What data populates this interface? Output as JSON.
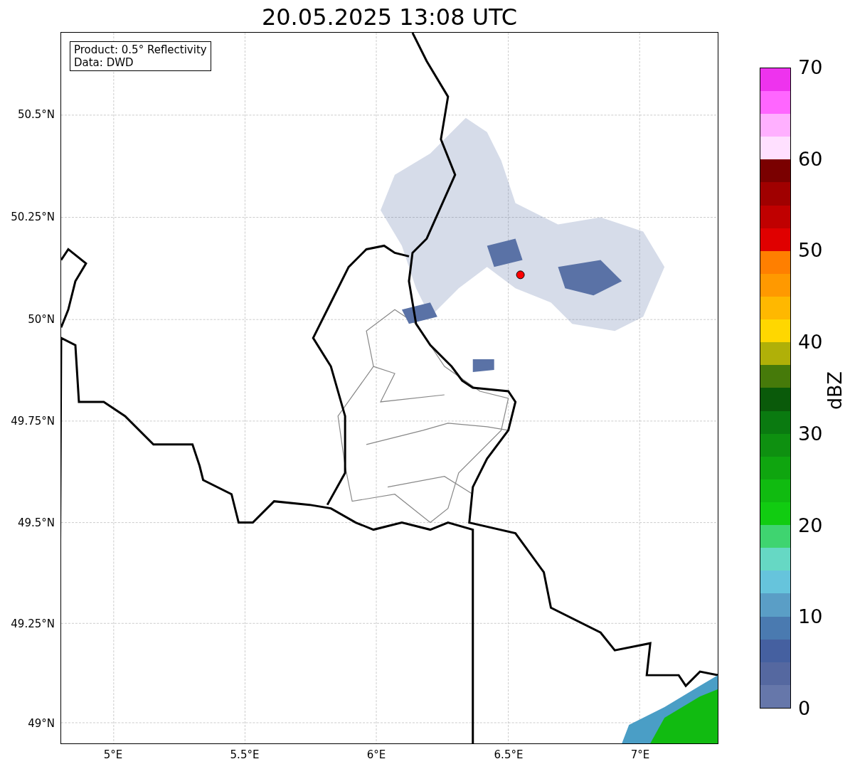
{
  "title": "20.05.2025 13:08 UTC",
  "info_box": {
    "lines": [
      "Product: 0.5° Reflectivity",
      "Data: DWD"
    ]
  },
  "map": {
    "y_axis_labels": [
      "50.5°N",
      "50.25°N",
      "50°N",
      "49.75°N",
      "49.5°N",
      "49.25°N",
      "49°N"
    ],
    "x_axis_labels": [
      "5°E",
      "5.5°E",
      "6°E",
      "6.5°E",
      "7°E"
    ]
  },
  "colorbar": {
    "label": "dBZ",
    "ticks": [
      "70",
      "60",
      "50",
      "40",
      "30",
      "20",
      "10",
      "0"
    ],
    "segments": [
      {
        "color": "#6677aa"
      },
      {
        "color": "#5568a0"
      },
      {
        "color": "#4560a0"
      },
      {
        "color": "#4a7ab0"
      },
      {
        "color": "#5a9ec6"
      },
      {
        "color": "#66c4dc"
      },
      {
        "color": "#66d8c4"
      },
      {
        "color": "#3fd470"
      },
      {
        "color": "#11cc11"
      },
      {
        "color": "#10bb10"
      },
      {
        "color": "#0fa50f"
      },
      {
        "color": "#0e9010"
      },
      {
        "color": "#0a7a10"
      },
      {
        "color": "#0a5a0a"
      },
      {
        "color": "#467a0a"
      },
      {
        "color": "#b0b008"
      },
      {
        "color": "#ffd700"
      },
      {
        "color": "#ffb800"
      },
      {
        "color": "#ff9900"
      },
      {
        "color": "#ff7f00"
      },
      {
        "color": "#e00000"
      },
      {
        "color": "#c00000"
      },
      {
        "color": "#a00000"
      },
      {
        "color": "#7a0000"
      },
      {
        "color": "#ffe0ff"
      },
      {
        "color": "#ffb0ff"
      },
      {
        "color": "#ff66ff"
      },
      {
        "color": "#ee33ee"
      }
    ]
  }
}
